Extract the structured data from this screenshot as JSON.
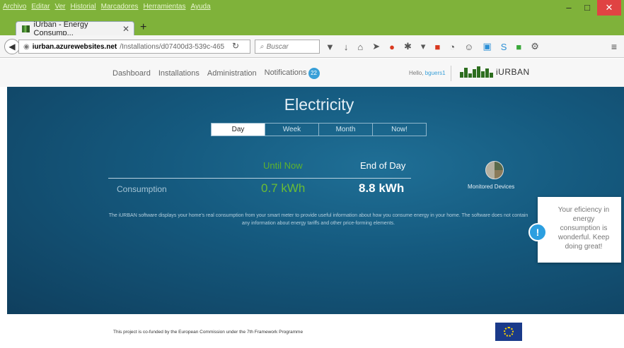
{
  "window": {
    "menu": [
      "Archivo",
      "Editar",
      "Ver",
      "Historial",
      "Marcadores",
      "Herramientas",
      "Ayuda"
    ],
    "minimize": "–",
    "maximize": "□",
    "close": "✕"
  },
  "tab": {
    "title": "iUrban - Energy Consump...",
    "close": "✕",
    "new_tab": "+"
  },
  "navbar": {
    "url_host": "iurban.azurewebsites.net",
    "url_path": "/Installations/d07400d3-539c-465",
    "search_placeholder": "Buscar",
    "icons": [
      "bookmark-pocket-icon",
      "download-icon",
      "home-icon",
      "send-icon",
      "ublock-icon",
      "addon-icon",
      "dropdown-icon",
      "red-addon-icon",
      "history-icon",
      "chat-icon",
      "notification-icon",
      "skype-icon",
      "green-addon-icon",
      "tools-icon",
      "menu-icon"
    ],
    "notify_count": "0"
  },
  "site": {
    "nav": [
      "Dashboard",
      "Installations",
      "Administration",
      "Notifications"
    ],
    "notifications_count": "22",
    "hello": "Hello,",
    "username": "bguers1",
    "brand": "iURBAN"
  },
  "hero": {
    "title": "Electricity",
    "periods": [
      "Day",
      "Week",
      "Month",
      "Now!"
    ],
    "selected_period": "Day",
    "until_now_label": "Until Now",
    "end_of_day_label": "End of Day",
    "consumption_label": "Consumption",
    "until_now_value": "0.7 kWh",
    "end_of_day_value": "8.8 kWh",
    "monitored_devices": "Monitored Devices",
    "disclaimer": "The iURBAN software displays your home's real consumption from your smart meter to provide useful information about how you consume energy in your home. The software does not contain any information about energy tariffs and other price-forming elements."
  },
  "toast": {
    "icon": "!",
    "message": "Your eficiency in energy consumption is wonderful. Keep doing great!"
  },
  "footer": {
    "note": "This project is co-funded by the European Commission under the 7th Framework Programme"
  },
  "colors": {
    "green_accent": "#6bbd34",
    "blue_badge": "#3aa0d8",
    "hero_bg": "#155a7f",
    "chrome_green": "#7fb23a"
  }
}
